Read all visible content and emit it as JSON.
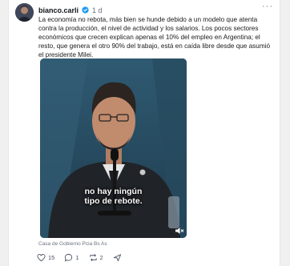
{
  "post": {
    "username": "bianco.carli",
    "time": "1 d",
    "more_label": "···",
    "text": "La economía no rebota, más bien se hunde debido a un modelo que atenta contra la producción, el nivel de actividad y los salarios. Los pocos sectores económicos que crecen explican apenas el 10% del empleo en Argentina; el resto, que genera el otro 90% del trabajo, está en caída libre desde que asumió el presidente Milei.",
    "video": {
      "caption_line1": "no hay ningún",
      "caption_line2": "tipo de rebote."
    },
    "source": "Casa de Gobierno Pcia Bs As",
    "actions": {
      "likes": "15",
      "comments": "1",
      "reposts": "2"
    }
  },
  "colors": {
    "verified_blue": "#1d9bf0",
    "muted_gray": "#6b7280"
  },
  "icons": [
    "verified-badge-icon",
    "heart-icon",
    "comment-icon",
    "repost-icon",
    "share-icon",
    "mute-icon"
  ]
}
